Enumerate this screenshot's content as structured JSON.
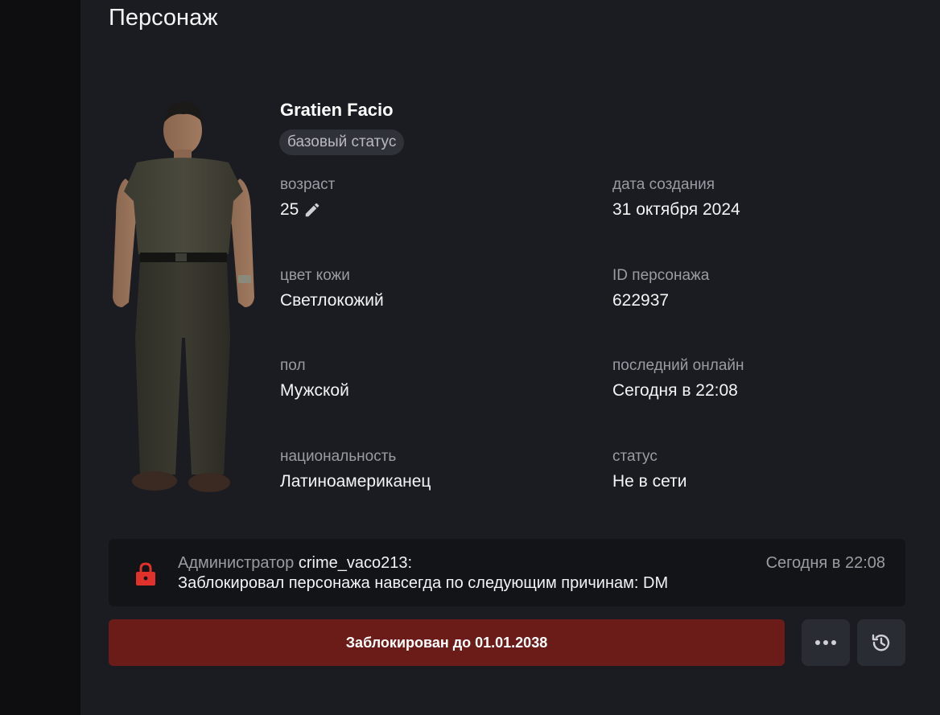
{
  "page": {
    "title": "Персонаж"
  },
  "character": {
    "name": "Gratien Facio",
    "status_chip": "базовый статус",
    "fields": {
      "age": {
        "label": "возраст",
        "value": "25"
      },
      "created": {
        "label": "дата создания",
        "value": "31 октября 2024"
      },
      "skin": {
        "label": "цвет кожи",
        "value": "Светлокожий"
      },
      "id": {
        "label": "ID персонажа",
        "value": "622937"
      },
      "gender": {
        "label": "пол",
        "value": "Мужской"
      },
      "last_online": {
        "label": "последний онлайн",
        "value": "Сегодня в 22:08"
      },
      "nationality": {
        "label": "национальность",
        "value": "Латиноамериканец"
      },
      "status": {
        "label": "статус",
        "value": "Не в сети"
      }
    }
  },
  "log": {
    "prefix": "Администратор",
    "admin": "crime_vaco213:",
    "message": "Заблокировал персонажа навсегда по следующим причинам: DM",
    "time": "Сегодня в 22:08",
    "icon": "lock-icon"
  },
  "actions": {
    "ban_label": "Заблокирован до 01.01.2038",
    "more_icon": "more-dots-icon",
    "history_icon": "history-icon"
  },
  "colors": {
    "panel_bg": "#1b1c21",
    "ban_button": "#6b1c18",
    "lock_red": "#e0312a"
  }
}
